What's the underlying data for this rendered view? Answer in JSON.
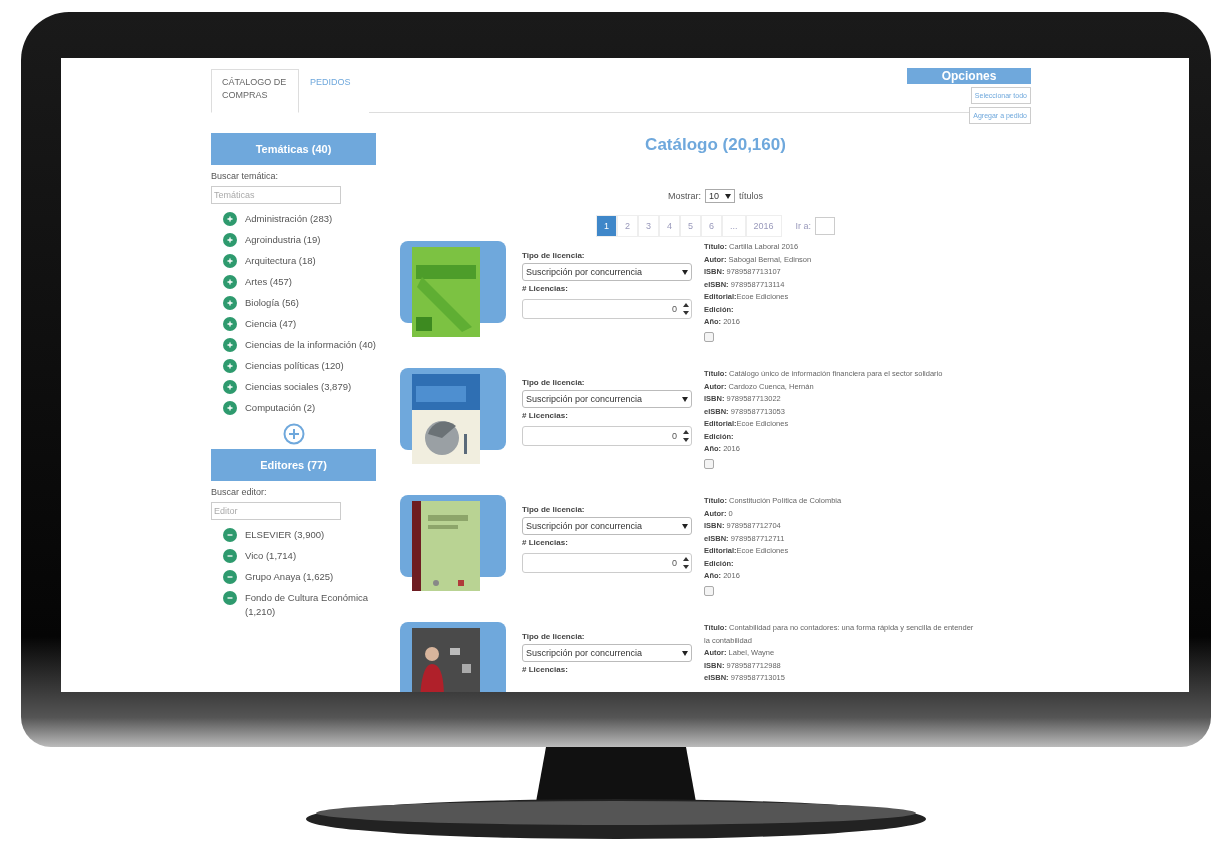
{
  "tabs": [
    {
      "label": "CÁTALOGO DE COMPRAS",
      "selected": true
    },
    {
      "label": "PEDIDOS",
      "selected": false
    }
  ],
  "options": {
    "title": "Opciones",
    "buttons": [
      "Seleccionar todo",
      "Agregar a pedido"
    ]
  },
  "topics": {
    "title": "Temáticas (40)",
    "search_label": "Buscar temática:",
    "placeholder": "Temáticas",
    "items": [
      "Administración (283)",
      "Agroindustria (19)",
      "Arquitectura (18)",
      "Artes (457)",
      "Biología (56)",
      "Ciencia (47)",
      "Ciencias de la información (40)",
      "Ciencias políticas (120)",
      "Ciencias sociales (3,879)",
      "Computación (2)"
    ]
  },
  "editors": {
    "title": "Editores (77)",
    "search_label": "Buscar editor:",
    "placeholder": "Editor",
    "items": [
      "ELSEVIER (3,900)",
      "Vico (1,714)",
      "Grupo Anaya (1,625)",
      "Fondo de Cultura Económica (1,210)"
    ]
  },
  "catalog": {
    "title": "Catálogo (20,160)",
    "show_label": "Mostrar:",
    "show_value": "10",
    "show_suffix": "títulos",
    "pages": [
      {
        "label": "1",
        "selected": true
      },
      {
        "label": "2",
        "selected": false
      },
      {
        "label": "3",
        "selected": false
      },
      {
        "label": "4",
        "selected": false
      },
      {
        "label": "5",
        "selected": false
      },
      {
        "label": "6",
        "selected": false
      },
      {
        "label": "...",
        "selected": false
      },
      {
        "label": "2016",
        "selected": false
      }
    ],
    "goto_label": "Ir a:"
  },
  "books": [
    {
      "license_label": "Tipo de licencia:",
      "license": "Suscripción por concurrencia",
      "licenses_label": "# Licencias:",
      "quantity": "0",
      "checked": false,
      "details": [
        "**Título:** Cartilla Laboral 2016",
        "**Autor:** Sabogal Bernal, Edinson",
        "**ISBN:** 9789587713107",
        "**eISBN:** 9789587713114",
        "**Editorial:**Ecoe Ediciones",
        "**Edición:**",
        "**Año:** 2016"
      ]
    },
    {
      "license_label": "Tipo de licencia:",
      "license": "Suscripción por concurrencia",
      "licenses_label": "# Licencias:",
      "quantity": "0",
      "checked": false,
      "details": [
        "**Título:** Catálogo único de información financiera para el sector solidario",
        "**Autor:** Cardozo Cuenca, Hernán",
        "**ISBN:** 9789587713022",
        "**eISBN:** 9789587713053",
        "**Editorial:**Ecoe Ediciones",
        "**Edición:**",
        "**Año:** 2016"
      ]
    },
    {
      "license_label": "Tipo de licencia:",
      "license": "Suscripción por concurrencia",
      "licenses_label": "# Licencias:",
      "quantity": "0",
      "checked": false,
      "details": [
        "**Título:** Constitución Política de Colombia",
        "**Autor:** 0",
        "**ISBN:** 9789587712704",
        "**eISBN:** 9789587712711",
        "**Editorial:**Ecoe Ediciones",
        "**Edición:**",
        "**Año:** 2016"
      ]
    },
    {
      "license_label": "Tipo de licencia:",
      "license": "Suscripción por concurrencia",
      "licenses_label": "# Licencias:",
      "details": [
        "**Título:** Contabilidad para no contadores: una forma rápida y sencilla de entender la contabilidad",
        "**Autor:** Label, Wayne",
        "**ISBN:** 9789587712988",
        "**eISBN:** 9789587713015"
      ]
    }
  ]
}
